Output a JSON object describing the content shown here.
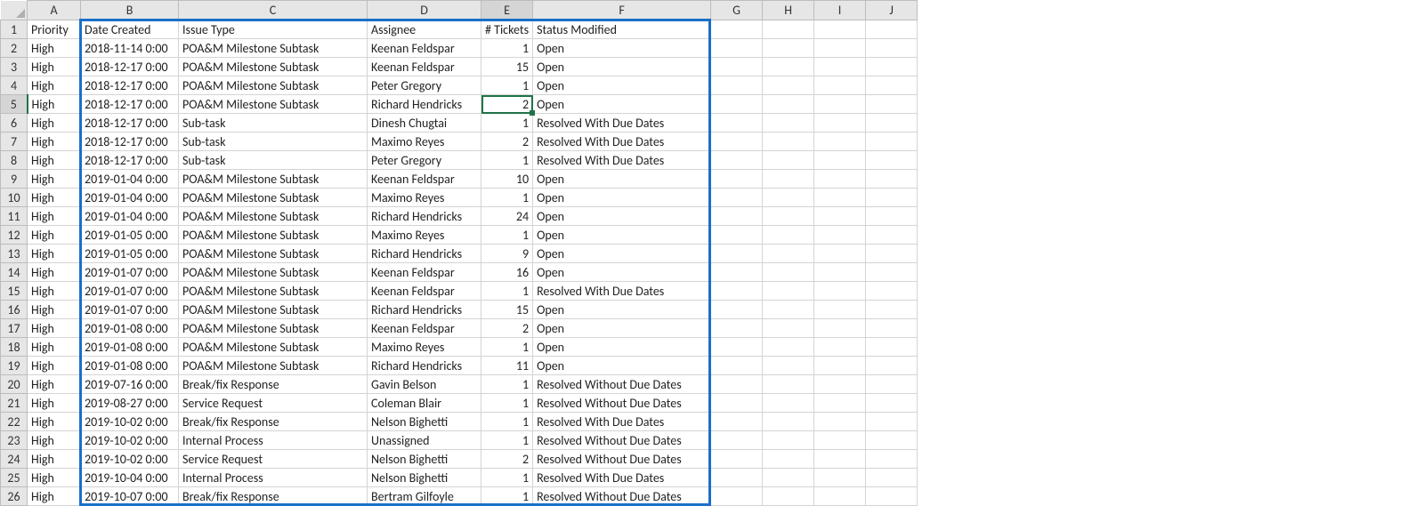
{
  "columns": [
    "A",
    "B",
    "C",
    "D",
    "E",
    "F",
    "G",
    "H",
    "I",
    "J"
  ],
  "activeCell": {
    "row": 5,
    "col": "E"
  },
  "headers": {
    "A": "Priority",
    "B": "Date Created",
    "C": "Issue Type",
    "D": "Assignee",
    "E": "# Tickets",
    "F": "Status Modified"
  },
  "rows": [
    {
      "A": "High",
      "B": "2018-11-14 0:00",
      "C": "POA&M Milestone Subtask",
      "D": "Keenan Feldspar",
      "E": 1,
      "F": "Open"
    },
    {
      "A": "High",
      "B": "2018-12-17 0:00",
      "C": "POA&M Milestone Subtask",
      "D": "Keenan Feldspar",
      "E": 15,
      "F": "Open"
    },
    {
      "A": "High",
      "B": "2018-12-17 0:00",
      "C": "POA&M Milestone Subtask",
      "D": "Peter Gregory",
      "E": 1,
      "F": "Open"
    },
    {
      "A": "High",
      "B": "2018-12-17 0:00",
      "C": "POA&M Milestone Subtask",
      "D": "Richard Hendricks",
      "E": 2,
      "F": "Open"
    },
    {
      "A": "High",
      "B": "2018-12-17 0:00",
      "C": "Sub-task",
      "D": "Dinesh Chugtai",
      "E": 1,
      "F": "Resolved With Due Dates"
    },
    {
      "A": "High",
      "B": "2018-12-17 0:00",
      "C": "Sub-task",
      "D": "Maximo Reyes",
      "E": 2,
      "F": "Resolved With Due Dates"
    },
    {
      "A": "High",
      "B": "2018-12-17 0:00",
      "C": "Sub-task",
      "D": "Peter Gregory",
      "E": 1,
      "F": "Resolved With Due Dates"
    },
    {
      "A": "High",
      "B": "2019-01-04 0:00",
      "C": "POA&M Milestone Subtask",
      "D": "Keenan Feldspar",
      "E": 10,
      "F": "Open"
    },
    {
      "A": "High",
      "B": "2019-01-04 0:00",
      "C": "POA&M Milestone Subtask",
      "D": "Maximo Reyes",
      "E": 1,
      "F": "Open"
    },
    {
      "A": "High",
      "B": "2019-01-04 0:00",
      "C": "POA&M Milestone Subtask",
      "D": "Richard Hendricks",
      "E": 24,
      "F": "Open"
    },
    {
      "A": "High",
      "B": "2019-01-05 0:00",
      "C": "POA&M Milestone Subtask",
      "D": "Maximo Reyes",
      "E": 1,
      "F": "Open"
    },
    {
      "A": "High",
      "B": "2019-01-05 0:00",
      "C": "POA&M Milestone Subtask",
      "D": "Richard Hendricks",
      "E": 9,
      "F": "Open"
    },
    {
      "A": "High",
      "B": "2019-01-07 0:00",
      "C": "POA&M Milestone Subtask",
      "D": "Keenan Feldspar",
      "E": 16,
      "F": "Open"
    },
    {
      "A": "High",
      "B": "2019-01-07 0:00",
      "C": "POA&M Milestone Subtask",
      "D": "Keenan Feldspar",
      "E": 1,
      "F": "Resolved With Due Dates"
    },
    {
      "A": "High",
      "B": "2019-01-07 0:00",
      "C": "POA&M Milestone Subtask",
      "D": "Richard Hendricks",
      "E": 15,
      "F": "Open"
    },
    {
      "A": "High",
      "B": "2019-01-08 0:00",
      "C": "POA&M Milestone Subtask",
      "D": "Keenan Feldspar",
      "E": 2,
      "F": "Open"
    },
    {
      "A": "High",
      "B": "2019-01-08 0:00",
      "C": "POA&M Milestone Subtask",
      "D": "Maximo Reyes",
      "E": 1,
      "F": "Open"
    },
    {
      "A": "High",
      "B": "2019-01-08 0:00",
      "C": "POA&M Milestone Subtask",
      "D": "Richard Hendricks",
      "E": 11,
      "F": "Open"
    },
    {
      "A": "High",
      "B": "2019-07-16 0:00",
      "C": "Break/fix Response",
      "D": "Gavin Belson",
      "E": 1,
      "F": "Resolved Without Due Dates"
    },
    {
      "A": "High",
      "B": "2019-08-27 0:00",
      "C": "Service Request",
      "D": "Coleman Blair",
      "E": 1,
      "F": "Resolved Without Due Dates"
    },
    {
      "A": "High",
      "B": "2019-10-02 0:00",
      "C": "Break/fix Response",
      "D": "Nelson Bighetti",
      "E": 1,
      "F": "Resolved With Due Dates"
    },
    {
      "A": "High",
      "B": "2019-10-02 0:00",
      "C": "Internal Process",
      "D": "Unassigned",
      "E": 1,
      "F": "Resolved Without Due Dates"
    },
    {
      "A": "High",
      "B": "2019-10-02 0:00",
      "C": "Service Request",
      "D": "Nelson Bighetti",
      "E": 2,
      "F": "Resolved Without Due Dates"
    },
    {
      "A": "High",
      "B": "2019-10-04 0:00",
      "C": "Internal Process",
      "D": "Nelson Bighetti",
      "E": 1,
      "F": "Resolved With Due Dates"
    },
    {
      "A": "High",
      "B": "2019-10-07 0:00",
      "C": "Break/fix Response",
      "D": "Bertram Gilfoyle",
      "E": 1,
      "F": "Resolved Without Due Dates"
    }
  ],
  "highlightRange": {
    "fromCol": "B",
    "toCol": "F",
    "fromRow": 1,
    "toRow": 26
  }
}
